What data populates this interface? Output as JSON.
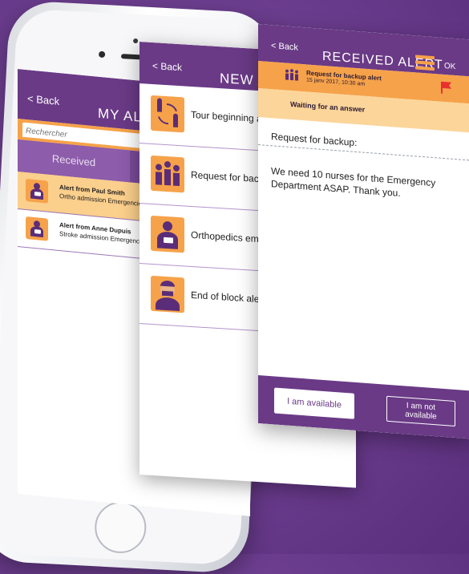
{
  "colors": {
    "purple": "#6a3a86",
    "orange": "#f6a24a",
    "light_orange": "#fcd59a"
  },
  "my_alerts": {
    "back_label": "< Back",
    "title": "MY ALERTS",
    "search_placeholder": "Rechercher",
    "tab_received": "Received",
    "alerts": [
      {
        "title": "Alert from Paul Smith",
        "subtitle": "Ortho admission Emergencies",
        "icon": "orthopedics-icon"
      },
      {
        "title": "Alert from Anne Dupuis",
        "subtitle": "Stroke admission Emergencies",
        "icon": "orthopedics-icon"
      }
    ]
  },
  "new_alert": {
    "back_label": "< Back",
    "title": "NEW ALERT",
    "items": [
      {
        "label": "Tour beginning alert",
        "icon": "chess-rotation-icon"
      },
      {
        "label": "Request for backup alert",
        "icon": "group-people-icon"
      },
      {
        "label": "Orthopedics emergency alert",
        "icon": "orthopedics-icon"
      },
      {
        "label": "End of block alert",
        "icon": "surgeon-icon"
      }
    ]
  },
  "received_alert": {
    "back_label": "< Back",
    "title": "RECEIVED ALERT",
    "ok_label": "OK",
    "alert_title": "Request for backup alert",
    "alert_date": "15 janv 2017, 10:30 am",
    "status": "Waiting for an answer",
    "request_label": "Request for backup:",
    "message": "We need 10 nurses for the Emergency Department ASAP. Thank you.",
    "btn_available": "I am available",
    "btn_not_available": "I am not available"
  }
}
